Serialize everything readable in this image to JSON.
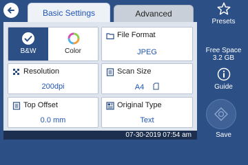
{
  "tabs": {
    "basic": "Basic Settings",
    "advanced": "Advanced"
  },
  "modes": {
    "bw": "B&W",
    "color": "Color"
  },
  "tiles": {
    "file_format": {
      "label": "File Format",
      "value": "JPEG"
    },
    "resolution": {
      "label": "Resolution",
      "value": "200dpi"
    },
    "scan_size": {
      "label": "Scan Size",
      "value": "A4"
    },
    "top_offset": {
      "label": "Top Offset",
      "value": "0.0 mm"
    },
    "original_type": {
      "label": "Original Type",
      "value": "Text"
    }
  },
  "sidebar": {
    "presets": "Presets",
    "free_space_label": "Free Space",
    "free_space_value": "3.2 GB",
    "guide": "Guide",
    "save": "Save"
  },
  "status": {
    "datetime": "07-30-2019 07:54 am"
  },
  "icons": {
    "back": "back-arrow-icon",
    "presets": "star-icon",
    "guide": "info-icon",
    "save": "save-diamond-icon"
  },
  "colors": {
    "accent": "#2c4f86",
    "value_text": "#1f55b3"
  }
}
